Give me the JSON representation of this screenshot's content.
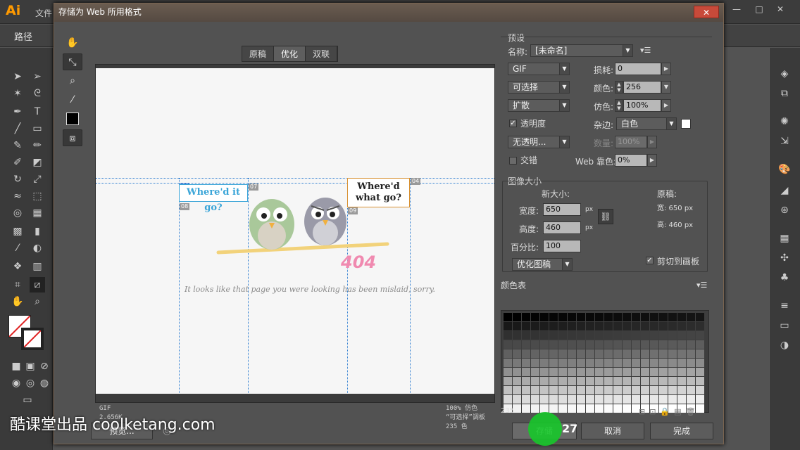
{
  "app": {
    "logo": "Ai",
    "menu_first": "文件",
    "control_label": "路径",
    "win_min": "—",
    "win_max": "□",
    "win_close": "✕"
  },
  "dialog": {
    "title": "存储为 Web 所用格式",
    "close": "✕",
    "tabs": [
      {
        "label": "原稿"
      },
      {
        "label": "优化"
      },
      {
        "label": "双联"
      }
    ]
  },
  "preview": {
    "bubble1": "Where'd it go?",
    "bubble2_l1": "Where'd",
    "bubble2_l2": "what go?",
    "error": "404",
    "message": "It looks like that page you were looking has been mislaid, sorry.",
    "slices": [
      "06",
      "07",
      "03",
      "04",
      "08",
      "09"
    ],
    "info_left_1": "GIF",
    "info_left_2": "2.656K",
    "info_right_1": "100% 仿色",
    "info_right_2": "“可选择”调板",
    "info_right_3": "235 色"
  },
  "settings": {
    "preset_title": "预设",
    "name_label": "名称:",
    "name_value": "[未命名]",
    "format_value": "GIF",
    "lossy_label": "损耗:",
    "lossy_value": "0",
    "reduction_value": "可选择",
    "colors_label": "颜色:",
    "colors_value": "256",
    "dither_algo_value": "扩散",
    "dither_label": "仿色:",
    "dither_value": "100%",
    "transparency_label": "透明度",
    "transparency_checked": "✓",
    "matte_label": "杂边:",
    "matte_value": "白色",
    "trans_dither_value": "无透明...",
    "amount_label": "数量:",
    "amount_value": "100%",
    "interlaced_label": "交错",
    "web_snap_label": "Web 靠色:",
    "web_snap_value": "0%"
  },
  "image_size": {
    "title": "图像大小",
    "new_size_label": "新大小:",
    "width_label": "宽度:",
    "width_value": "650",
    "height_label": "高度:",
    "height_value": "460",
    "percent_label": "百分比:",
    "percent_value": "100",
    "unit": "px",
    "orig_label": "原稿:",
    "orig_width": "宽: 650 px",
    "orig_height": "高: 460 px",
    "optimize_value": "优化图稿",
    "clip_label": "剪切到画板",
    "clip_checked": "✓"
  },
  "color_table": {
    "title": "颜色表",
    "count": "235"
  },
  "buttons": {
    "preview": "预览...",
    "save": "存储",
    "cancel": "取消",
    "done": "完成"
  },
  "overlay": {
    "watermark": "酷课堂出品 coolketang.com",
    "step": "27"
  },
  "colors": {
    "accent_orange": "#ff9a00",
    "slice_blue": "#2a7bd0",
    "bubble_blue": "#3aa5d8",
    "bubble_orange": "#d89030",
    "error_pink": "#f08ab0",
    "green_marker": "#17c82a"
  }
}
